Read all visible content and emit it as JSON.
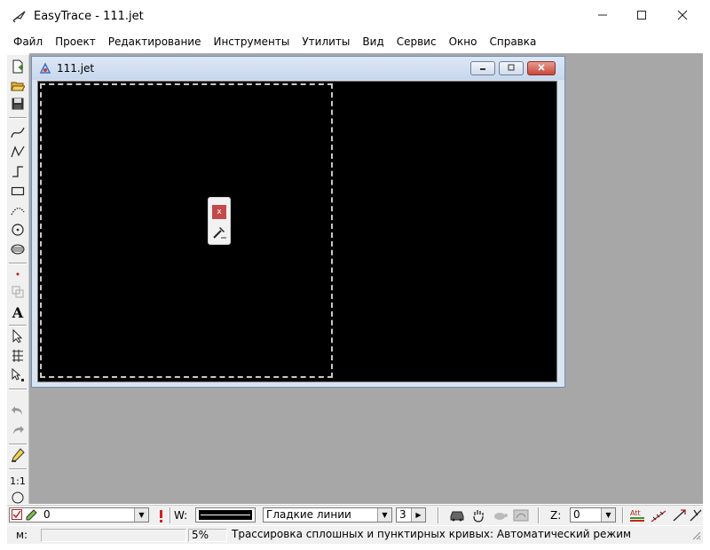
{
  "window": {
    "title": "EasyTrace - 111.jet",
    "app_icon": "easytrace-pen-icon",
    "controls": {
      "minimize": "minimize-icon",
      "maximize": "maximize-icon",
      "close": "close-icon"
    }
  },
  "menu": [
    "Файл",
    "Проект",
    "Редактирование",
    "Инструменты",
    "Утилиты",
    "Вид",
    "Сервис",
    "Окно",
    "Справка"
  ],
  "left_toolbar": {
    "tools": [
      "new-file-icon",
      "open-folder-icon",
      "save-icon",
      "curve-icon",
      "polyline-icon",
      "step-line-icon",
      "rectangle-icon",
      "dotted-arc-icon",
      "circle-point-icon",
      "hatched-ellipse-icon",
      "point-icon",
      "copy-object-icon",
      "text-tool-icon",
      "select-arrow-icon",
      "grid-select-icon",
      "select-plus-icon",
      "undo-icon",
      "redo-icon",
      "pencil-icon",
      "scale-one-to-one-icon",
      "circle-icon"
    ],
    "scale_label": "1:1",
    "text_tool_label": "A"
  },
  "child_window": {
    "title": "111.jet",
    "icon": "document-map-icon",
    "mini_tool": {
      "close_glyph": "x",
      "icon": "hammer-icon"
    }
  },
  "bottom_toolbar": {
    "layer_value": "0",
    "w_label": "W:",
    "line_type": "Гладкие линии",
    "width_value": "3",
    "z_label": "Z:",
    "z_value": "0"
  },
  "statusbar": {
    "m_label": "м:",
    "m_value": "",
    "percent": "5%",
    "message": "Трассировка сплошных и пунктирных кривых: Автоматический режим"
  },
  "colors": {
    "mdi_background": "#a7a7a7",
    "canvas": "#000000",
    "dashed_frame": "#c8c8c8",
    "close_red": "#c7463a",
    "toolbar": "#f0f0f0"
  }
}
